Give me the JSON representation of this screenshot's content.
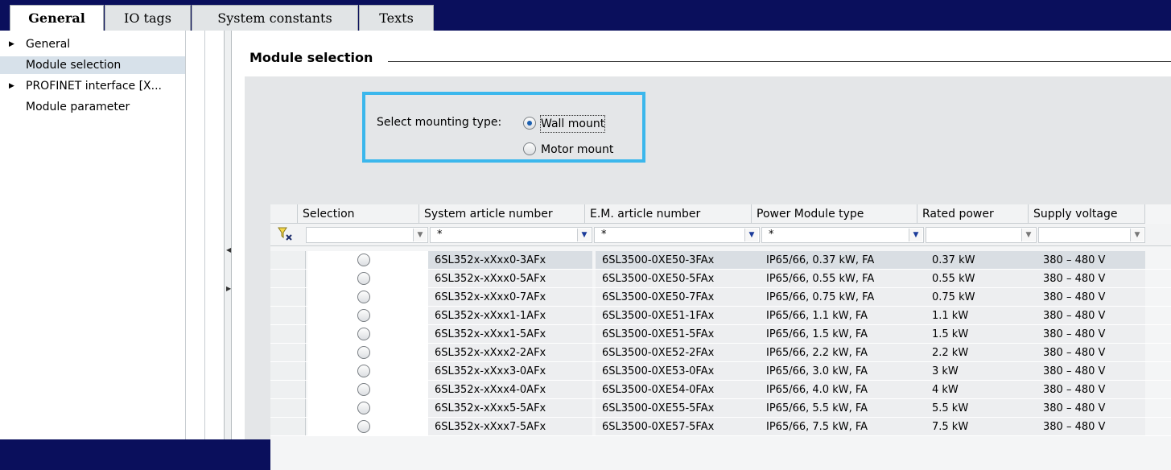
{
  "tabs": [
    {
      "label": "General"
    },
    {
      "label": "IO tags"
    },
    {
      "label": "System constants"
    },
    {
      "label": "Texts"
    }
  ],
  "nav": {
    "items": [
      {
        "label": "General",
        "expandable": true
      },
      {
        "label": "Module selection",
        "selected": true
      },
      {
        "label": "PROFINET interface [X...",
        "expandable": true
      },
      {
        "label": "Module parameter"
      }
    ]
  },
  "section": {
    "title": "Module selection"
  },
  "mounting": {
    "label": "Select mounting type:",
    "options": [
      {
        "label": "Wall mount",
        "checked": true
      },
      {
        "label": "Motor mount",
        "checked": false
      }
    ]
  },
  "table": {
    "headers": [
      "Selection",
      "System article number",
      "E.M. article number",
      "Power Module type",
      "Rated power",
      "Supply voltage"
    ],
    "filters": [
      "",
      "*",
      "*",
      "*",
      "",
      ""
    ],
    "rows": [
      [
        "6SL352x-xXxx0-3AFx",
        "6SL3500-0XE50-3FAx",
        "IP65/66, 0.37 kW, FA",
        "0.37 kW",
        "380 – 480 V"
      ],
      [
        "6SL352x-xXxx0-5AFx",
        "6SL3500-0XE50-5FAx",
        "IP65/66, 0.55 kW, FA",
        "0.55 kW",
        "380 – 480 V"
      ],
      [
        "6SL352x-xXxx0-7AFx",
        "6SL3500-0XE50-7FAx",
        "IP65/66, 0.75 kW, FA",
        "0.75 kW",
        "380 – 480 V"
      ],
      [
        "6SL352x-xXxx1-1AFx",
        "6SL3500-0XE51-1FAx",
        "IP65/66, 1.1 kW, FA",
        "1.1 kW",
        "380 – 480 V"
      ],
      [
        "6SL352x-xXxx1-5AFx",
        "6SL3500-0XE51-5FAx",
        "IP65/66, 1.5 kW, FA",
        "1.5 kW",
        "380 – 480 V"
      ],
      [
        "6SL352x-xXxx2-2AFx",
        "6SL3500-0XE52-2FAx",
        "IP65/66, 2.2 kW, FA",
        "2.2 kW",
        "380 – 480 V"
      ],
      [
        "6SL352x-xXxx3-0AFx",
        "6SL3500-0XE53-0FAx",
        "IP65/66, 3.0 kW, FA",
        "3 kW",
        "380 – 480 V"
      ],
      [
        "6SL352x-xXxx4-0AFx",
        "6SL3500-0XE54-0FAx",
        "IP65/66, 4.0 kW, FA",
        "4 kW",
        "380 – 480 V"
      ],
      [
        "6SL352x-xXxx5-5AFx",
        "6SL3500-0XE55-5FAx",
        "IP65/66, 5.5 kW, FA",
        "5.5 kW",
        "380 – 480 V"
      ],
      [
        "6SL352x-xXxx7-5AFx",
        "6SL3500-0XE57-5FAx",
        "IP65/66, 7.5 kW, FA",
        "7.5 kW",
        "380 – 480 V"
      ]
    ]
  },
  "colors": {
    "highlight_box": "#3bb7ec",
    "outer_background": "#0a0f5c"
  }
}
